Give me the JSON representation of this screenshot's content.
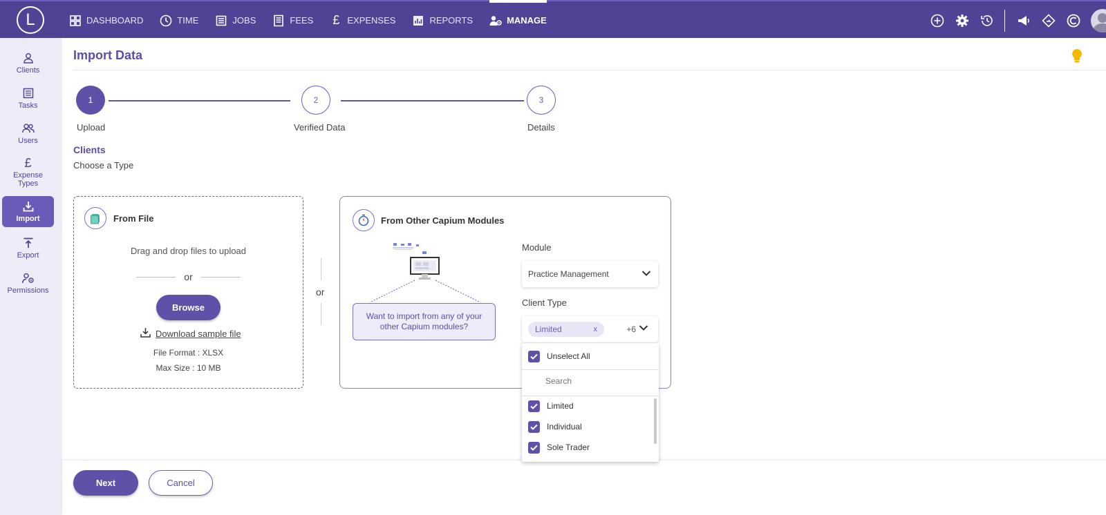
{
  "app": {
    "logo_letter": "L",
    "colors": {
      "primary": "#4f4396",
      "accent": "#5e52a8",
      "light": "#eeecf8",
      "bulb": "#f6b800"
    }
  },
  "nav": {
    "items": [
      {
        "label": "DASHBOARD",
        "icon": "dashboard-icon"
      },
      {
        "label": "TIME",
        "icon": "clock-icon"
      },
      {
        "label": "JOBS",
        "icon": "jobs-icon"
      },
      {
        "label": "FEES",
        "icon": "fees-icon"
      },
      {
        "label": "EXPENSES",
        "icon": "pound-icon"
      },
      {
        "label": "REPORTS",
        "icon": "reports-icon"
      },
      {
        "label": "MANAGE",
        "icon": "manage-users-icon",
        "active": true
      }
    ]
  },
  "sidebar": {
    "items": [
      {
        "label": "Clients",
        "icon": "user-icon"
      },
      {
        "label": "Tasks",
        "icon": "tasks-icon"
      },
      {
        "label": "Users",
        "icon": "users-icon"
      },
      {
        "label": "Expense Types",
        "icon": "pound-icon"
      },
      {
        "label": "Import",
        "icon": "import-icon",
        "active": true
      },
      {
        "label": "Export",
        "icon": "export-icon"
      },
      {
        "label": "Permissions",
        "icon": "permissions-icon"
      }
    ]
  },
  "page": {
    "title": "Import Data"
  },
  "steps": [
    {
      "number": "1",
      "label": "Upload",
      "state": "active"
    },
    {
      "number": "2",
      "label": "Verified Data",
      "state": "pending"
    },
    {
      "number": "3",
      "label": "Details",
      "state": "pending"
    }
  ],
  "section": {
    "title": "Clients",
    "subtitle": "Choose a Type"
  },
  "from_file": {
    "title": "From File",
    "drag_text": "Drag and drop files to upload",
    "or": "or",
    "browse_label": "Browse",
    "download_label": "Download sample file",
    "file_format": "File Format : XLSX",
    "max_size": "Max Size : 10 MB"
  },
  "divider_or": "or",
  "from_modules": {
    "title": "From Other Capium Modules",
    "bubble_text": "Want to import from any of your other Capium modules?",
    "module_label": "Module",
    "module_value": "Practice Management",
    "client_type_label": "Client Type",
    "client_type_chip": "Limited",
    "chip_remove": "x",
    "extra_count": "+6"
  },
  "dropdown": {
    "unselect_all": "Unselect All",
    "search_placeholder": "Search",
    "options": [
      {
        "label": "Limited",
        "checked": true
      },
      {
        "label": "Individual",
        "checked": true
      },
      {
        "label": "Sole Trader",
        "checked": true
      }
    ]
  },
  "footer": {
    "next_label": "Next",
    "cancel_label": "Cancel"
  }
}
